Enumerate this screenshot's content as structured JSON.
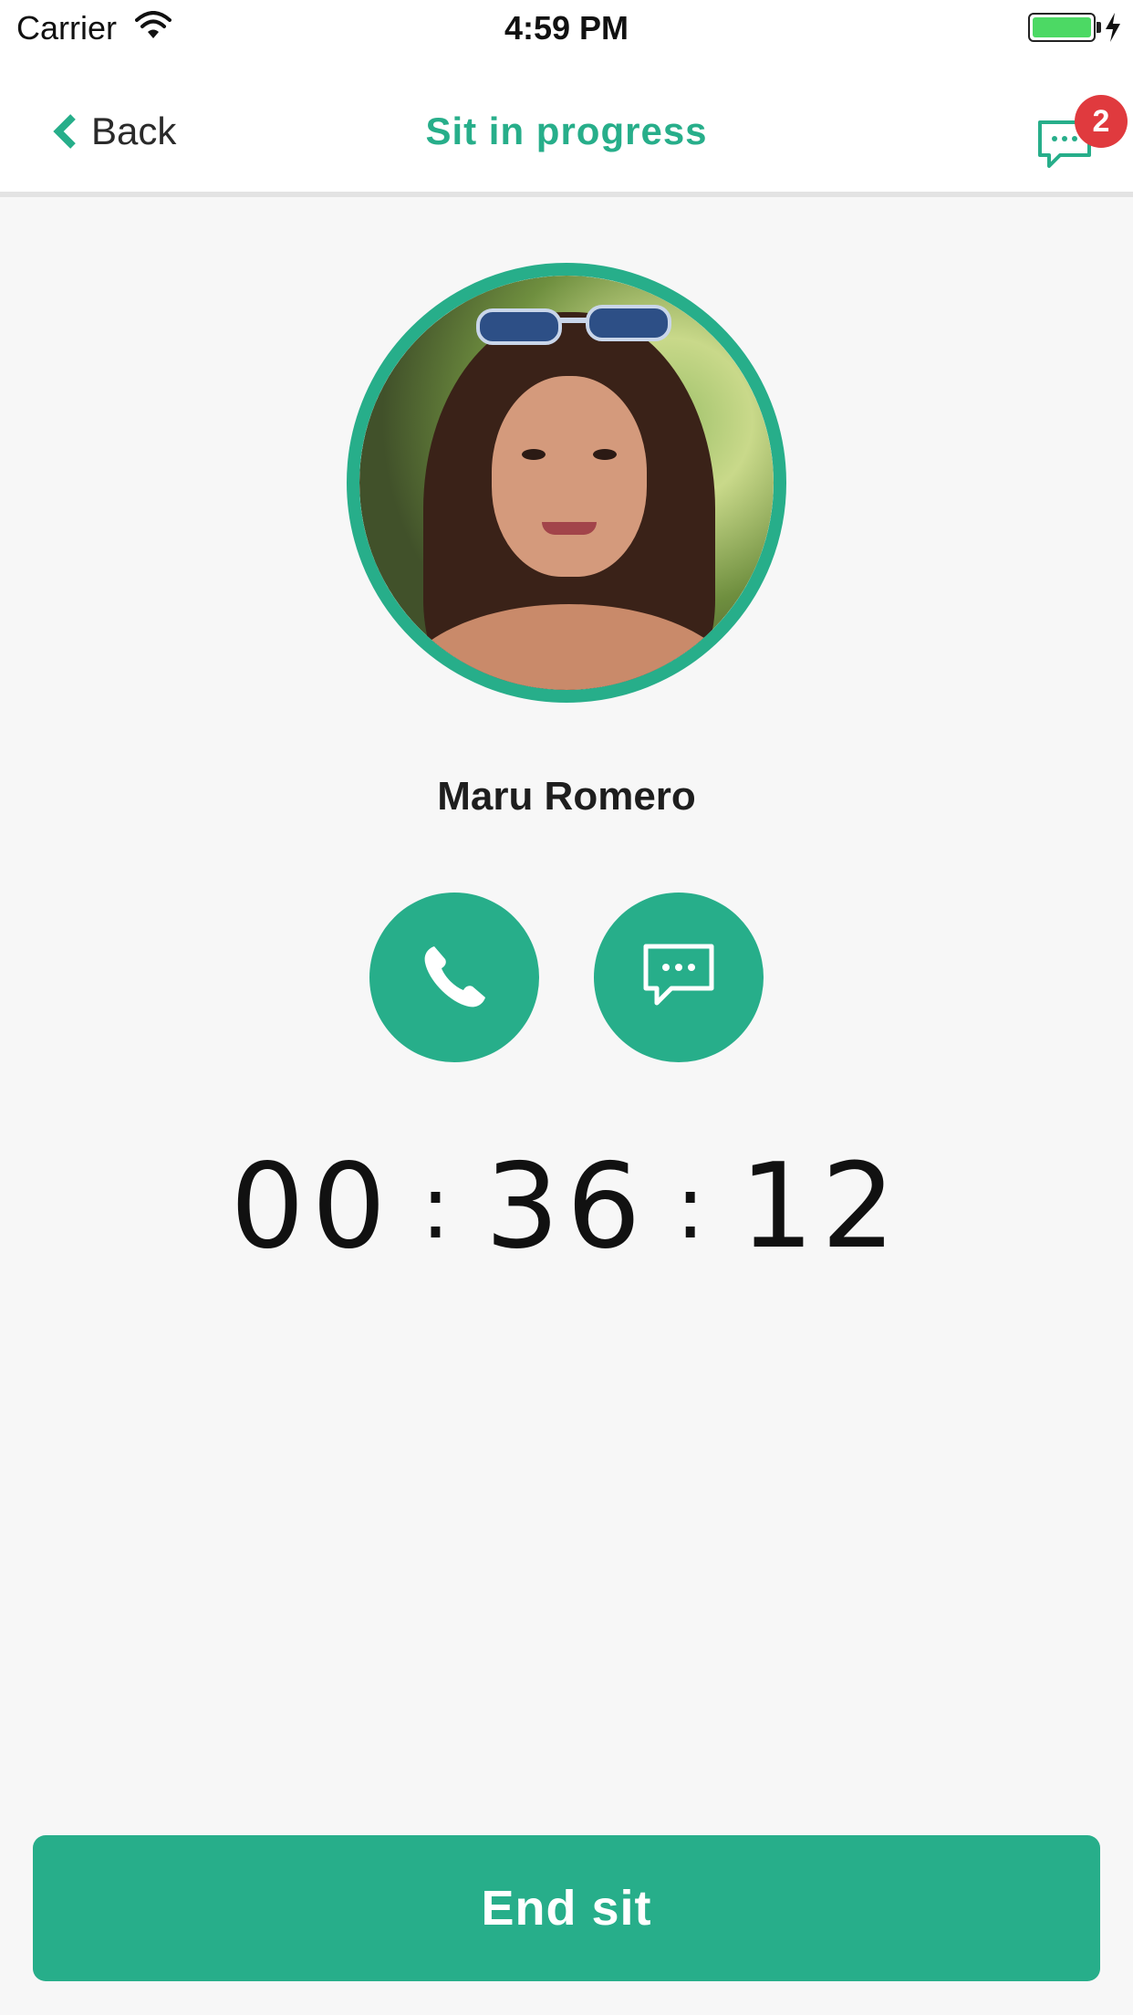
{
  "status_bar": {
    "carrier": "Carrier",
    "time": "4:59 PM",
    "wifi_icon": "wifi-icon",
    "battery_icon": "battery-charging-icon"
  },
  "nav": {
    "back_label": "Back",
    "back_icon": "chevron-left-icon",
    "title": "Sit in progress",
    "chat_icon": "chat-bubble-icon",
    "chat_badge": "2"
  },
  "profile": {
    "name": "Maru Romero",
    "avatar_icon": "avatar-photo"
  },
  "actions": {
    "call_icon": "phone-icon",
    "message_icon": "chat-bubble-icon"
  },
  "timer": {
    "hours": "00",
    "minutes": "36",
    "seconds": "12",
    "separator": ":"
  },
  "footer": {
    "end_label": "End sit"
  },
  "colors": {
    "accent": "#27ae8a",
    "badge": "#e03a3e",
    "background": "#f7f7f7"
  }
}
